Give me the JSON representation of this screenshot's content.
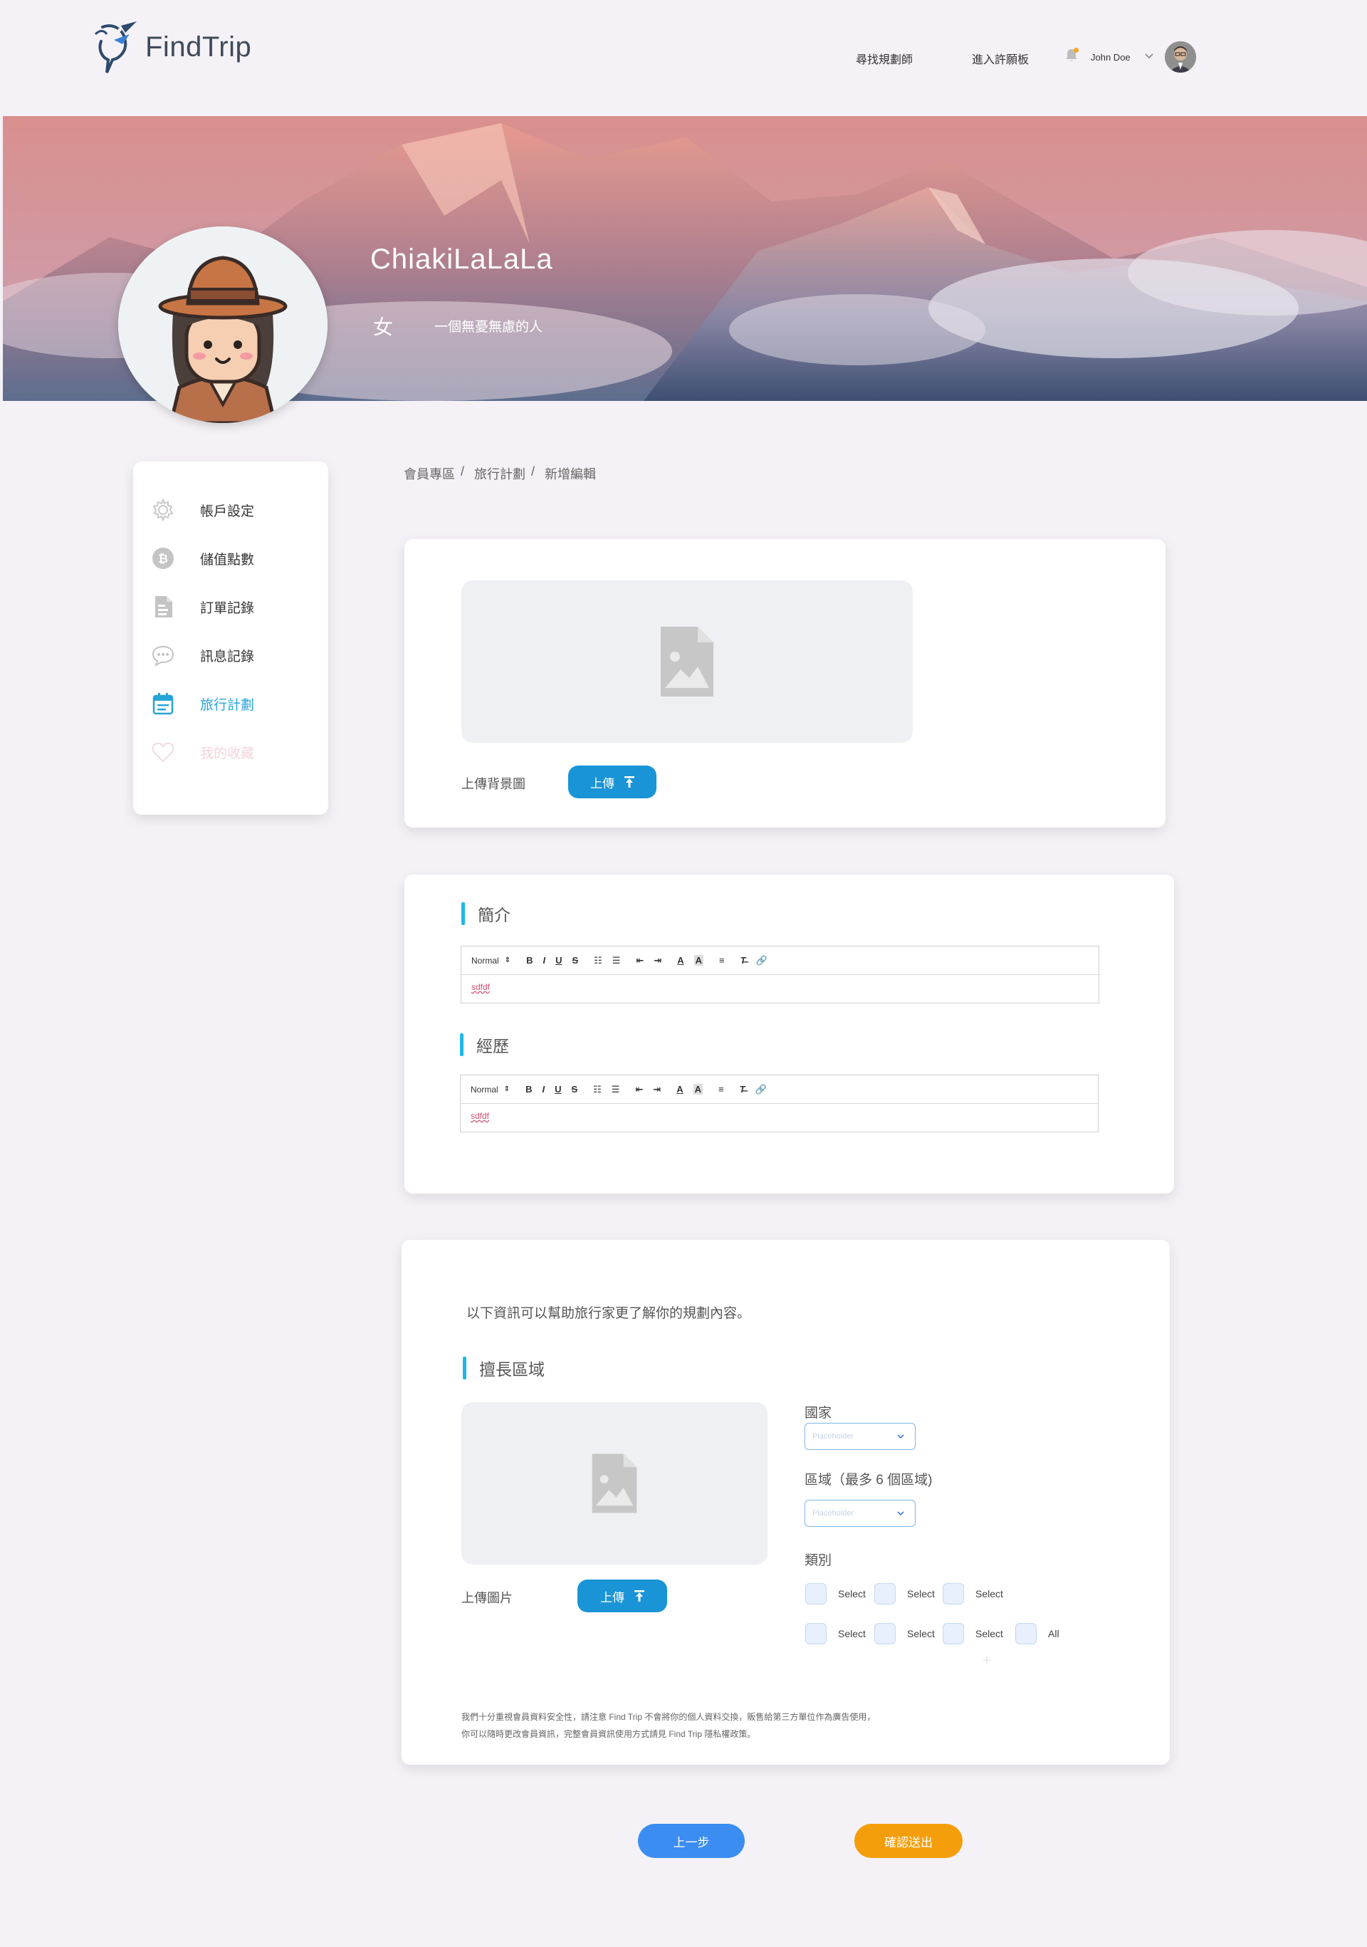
{
  "header": {
    "brand": "FindTrip",
    "nav": [
      "尋找規劃師",
      "進入許願板"
    ],
    "username": "John Doe"
  },
  "profile": {
    "name": "ChiakiLaLaLa",
    "gender": "女",
    "bio": "一個無憂無慮的人"
  },
  "sidebar": {
    "items": [
      {
        "label": "帳戶設定",
        "icon": "gear-icon"
      },
      {
        "label": "儲值點數",
        "icon": "coin-icon"
      },
      {
        "label": "訂單記錄",
        "icon": "document-icon"
      },
      {
        "label": "訊息記錄",
        "icon": "chat-bubble-icon"
      },
      {
        "label": "旅行計劃",
        "icon": "calendar-icon",
        "active": true
      },
      {
        "label": "我的收藏",
        "icon": "heart-icon",
        "disabled": true
      }
    ]
  },
  "breadcrumb": [
    "會員專區",
    "旅行計劃",
    "新增編輯"
  ],
  "background_card": {
    "upload_label": "上傳背景圖",
    "upload_button": "上傳"
  },
  "intro_card": {
    "sections": [
      {
        "title": "簡介",
        "toolbar_format": "Normal",
        "content": "sdfdf"
      },
      {
        "title": "經歷",
        "toolbar_format": "Normal",
        "content": "sdfdf"
      }
    ],
    "toolbar_buttons": [
      "B",
      "I",
      "U",
      "S"
    ]
  },
  "region_card": {
    "intro": "以下資訊可以幫助旅行家更了解你的規劃內容。",
    "section_title": "擅長區域",
    "upload_label": "上傳圖片",
    "upload_button": "上傳",
    "country_label": "國家",
    "country_placeholder": "Placeholder",
    "area_label": "區域（最多 6 個區域)",
    "area_placeholder": "Placeholder",
    "category_label": "類別",
    "categories_row1": [
      "Select",
      "Select",
      "Select"
    ],
    "categories_row2": [
      "Select",
      "Select",
      "Select",
      "All"
    ],
    "disclaimer_line1": "我們十分重視會員資料安全性，請注意 Find Trip 不會將你的個人資料交換，販售給第三方單位作為廣告使用，",
    "disclaimer_line2": "你可以隨時更改會員資訊，完整會員資訊使用方式請見 Find Trip 隱私權政策。"
  },
  "actions": {
    "prev": "上一步",
    "submit": "確認送出"
  },
  "colors": {
    "accent": "#1994d6",
    "active_nav": "#27a4d8",
    "section_bar": "#1fb7e8",
    "submit": "#f59e0b",
    "prev": "#3b8df2",
    "page_bg": "#f5f2f7"
  }
}
